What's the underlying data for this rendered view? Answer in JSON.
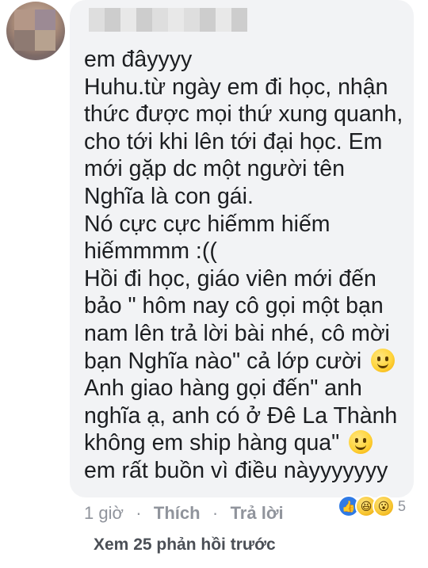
{
  "comment": {
    "lines": [
      "em đâyyyy",
      "Huhu.từ ngày em đi học, nhận",
      "thức được mọi thứ xung quanh,",
      "cho tới khi lên tới đại học. Em",
      "mới gặp dc một người tên",
      "Nghĩa là con gái.",
      "Nó cực cực hiếmm hiếm",
      "hiếmmmm :((",
      "Hồi đi học, giáo viên mới đến",
      "bảo \" hôm nay cô gọi một bạn",
      "nam lên trả lời bài nhé, cô mời",
      "bạn Nghĩa nào\" cả lớp cười",
      "Anh giao hàng gọi đến\" anh",
      "nghĩa ạ, anh có ở Đê La Thành",
      "không em ship hàng qua\"",
      "em rất buồn vì điều nàyyyyyyy"
    ],
    "emoji_icons": [
      "smiley-emoji-icon",
      "smiley-emoji-icon"
    ]
  },
  "actions": {
    "time": "1 giờ",
    "like_label": "Thích",
    "reply_label": "Trả lời"
  },
  "reactions": {
    "icons": [
      "like-reaction-icon",
      "haha-reaction-icon",
      "wow-reaction-icon"
    ],
    "count": "5"
  },
  "more_replies": "Xem 25 phản hồi trước"
}
